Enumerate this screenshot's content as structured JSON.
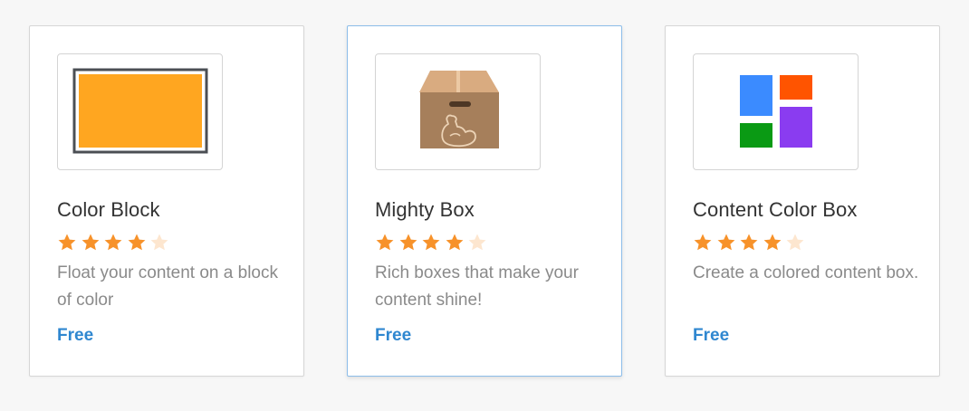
{
  "colors": {
    "star_filled": "#f7922a",
    "star_empty": "#fde6cf",
    "price": "#2f87d0",
    "active_border": "#8cbde9"
  },
  "cards": [
    {
      "title": "Color Block",
      "rating": 4,
      "rating_max": 5,
      "description": "Float your content on a block of color",
      "price": "Free",
      "icon": "color-block-icon"
    },
    {
      "title": "Mighty Box",
      "rating": 4,
      "rating_max": 5,
      "description": "Rich boxes that make your content shine!",
      "price": "Free",
      "icon": "mighty-box-icon"
    },
    {
      "title": "Content Color Box",
      "rating": 4,
      "rating_max": 5,
      "description": "Create a colored content box.",
      "price": "Free",
      "icon": "content-color-box-icon"
    }
  ]
}
